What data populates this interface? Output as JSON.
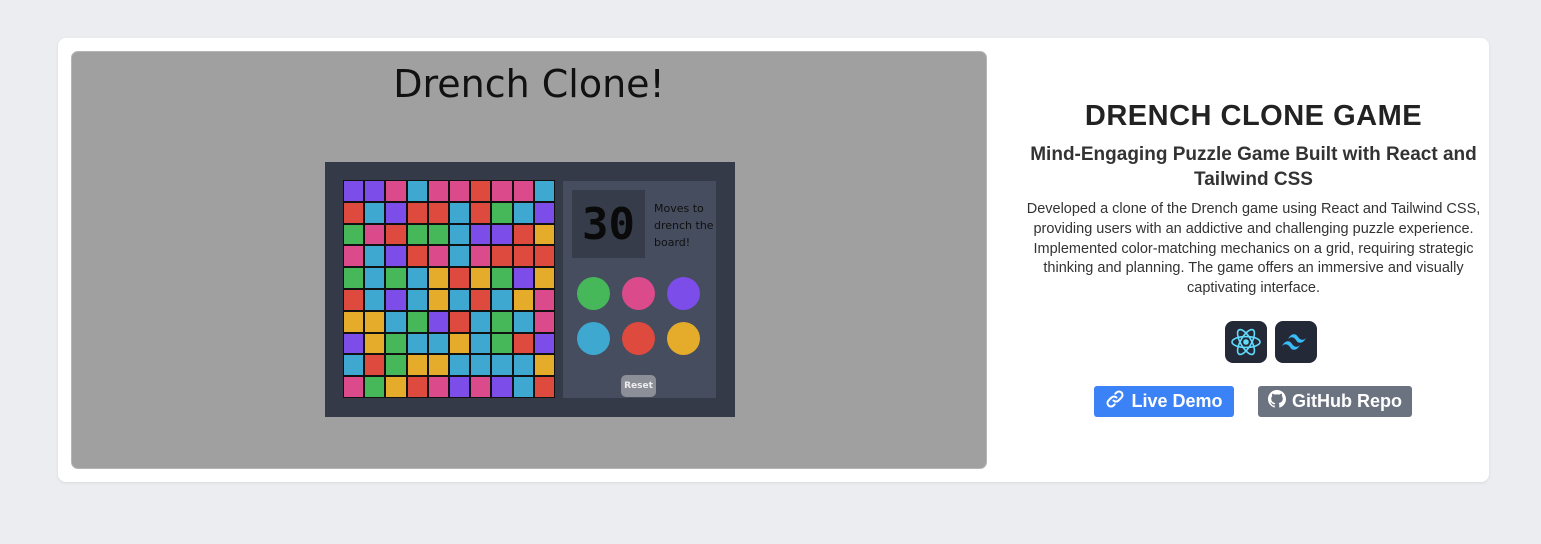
{
  "preview": {
    "game_title": "Drench Clone!",
    "moves": "30",
    "moves_label": "Moves to drench the board!",
    "reset_label": "Reset",
    "grid": [
      [
        "#7c4de8",
        "#7c4de8",
        "#db4b8c",
        "#3ea8d0",
        "#db4b8c",
        "#db4b8c",
        "#df4a3e",
        "#db4b8c",
        "#db4b8c",
        "#3ea8d0"
      ],
      [
        "#df4a3e",
        "#3ea8d0",
        "#7c4de8",
        "#df4a3e",
        "#df4a3e",
        "#3ea8d0",
        "#df4a3e",
        "#46b85a",
        "#3ea8d0",
        "#7c4de8"
      ],
      [
        "#46b85a",
        "#db4b8c",
        "#df4a3e",
        "#46b85a",
        "#46b85a",
        "#3ea8d0",
        "#7c4de8",
        "#7c4de8",
        "#df4a3e",
        "#e5ac2c"
      ],
      [
        "#db4b8c",
        "#3ea8d0",
        "#7c4de8",
        "#df4a3e",
        "#db4b8c",
        "#3ea8d0",
        "#db4b8c",
        "#df4a3e",
        "#df4a3e",
        "#df4a3e"
      ],
      [
        "#46b85a",
        "#3ea8d0",
        "#46b85a",
        "#3ea8d0",
        "#e5ac2c",
        "#df4a3e",
        "#e5ac2c",
        "#46b85a",
        "#7c4de8",
        "#e5ac2c"
      ],
      [
        "#df4a3e",
        "#3ea8d0",
        "#7c4de8",
        "#3ea8d0",
        "#e5ac2c",
        "#3ea8d0",
        "#df4a3e",
        "#3ea8d0",
        "#e5ac2c",
        "#db4b8c"
      ],
      [
        "#e5ac2c",
        "#e5ac2c",
        "#3ea8d0",
        "#46b85a",
        "#7c4de8",
        "#df4a3e",
        "#3ea8d0",
        "#46b85a",
        "#3ea8d0",
        "#db4b8c"
      ],
      [
        "#7c4de8",
        "#e5ac2c",
        "#46b85a",
        "#3ea8d0",
        "#3ea8d0",
        "#e5ac2c",
        "#3ea8d0",
        "#46b85a",
        "#df4a3e",
        "#7c4de8"
      ],
      [
        "#3ea8d0",
        "#df4a3e",
        "#46b85a",
        "#e5ac2c",
        "#e5ac2c",
        "#3ea8d0",
        "#3ea8d0",
        "#3ea8d0",
        "#3ea8d0",
        "#e5ac2c"
      ],
      [
        "#db4b8c",
        "#46b85a",
        "#e5ac2c",
        "#df4a3e",
        "#db4b8c",
        "#7c4de8",
        "#db4b8c",
        "#7c4de8",
        "#3ea8d0",
        "#df4a3e"
      ]
    ],
    "color_buttons": [
      {
        "name": "green",
        "color": "#46b85a"
      },
      {
        "name": "pink",
        "color": "#db4b8c"
      },
      {
        "name": "purple",
        "color": "#7c4de8"
      },
      {
        "name": "blue",
        "color": "#3ea8d0"
      },
      {
        "name": "red",
        "color": "#df4a3e"
      },
      {
        "name": "yellow",
        "color": "#e5ac2c"
      }
    ]
  },
  "project": {
    "title": "DRENCH CLONE GAME",
    "subtitle": "Mind-Engaging Puzzle Game Built with React and Tailwind CSS",
    "description": "Developed a clone of the Drench game using React and Tailwind CSS, providing users with an addictive and challenging puzzle experience. Implemented color-matching mechanics on a grid, requiring strategic thinking and planning. The game offers an immersive and visually captivating interface.",
    "tech": [
      {
        "icon": "react-icon",
        "color": "#61dafb"
      },
      {
        "icon": "tailwind-icon",
        "color": "#38bdf8"
      }
    ],
    "buttons": {
      "live_demo": "Live Demo",
      "github": "GitHub Repo"
    },
    "colors": {
      "live_demo": "#3b82f6",
      "github": "#6b7280"
    }
  }
}
